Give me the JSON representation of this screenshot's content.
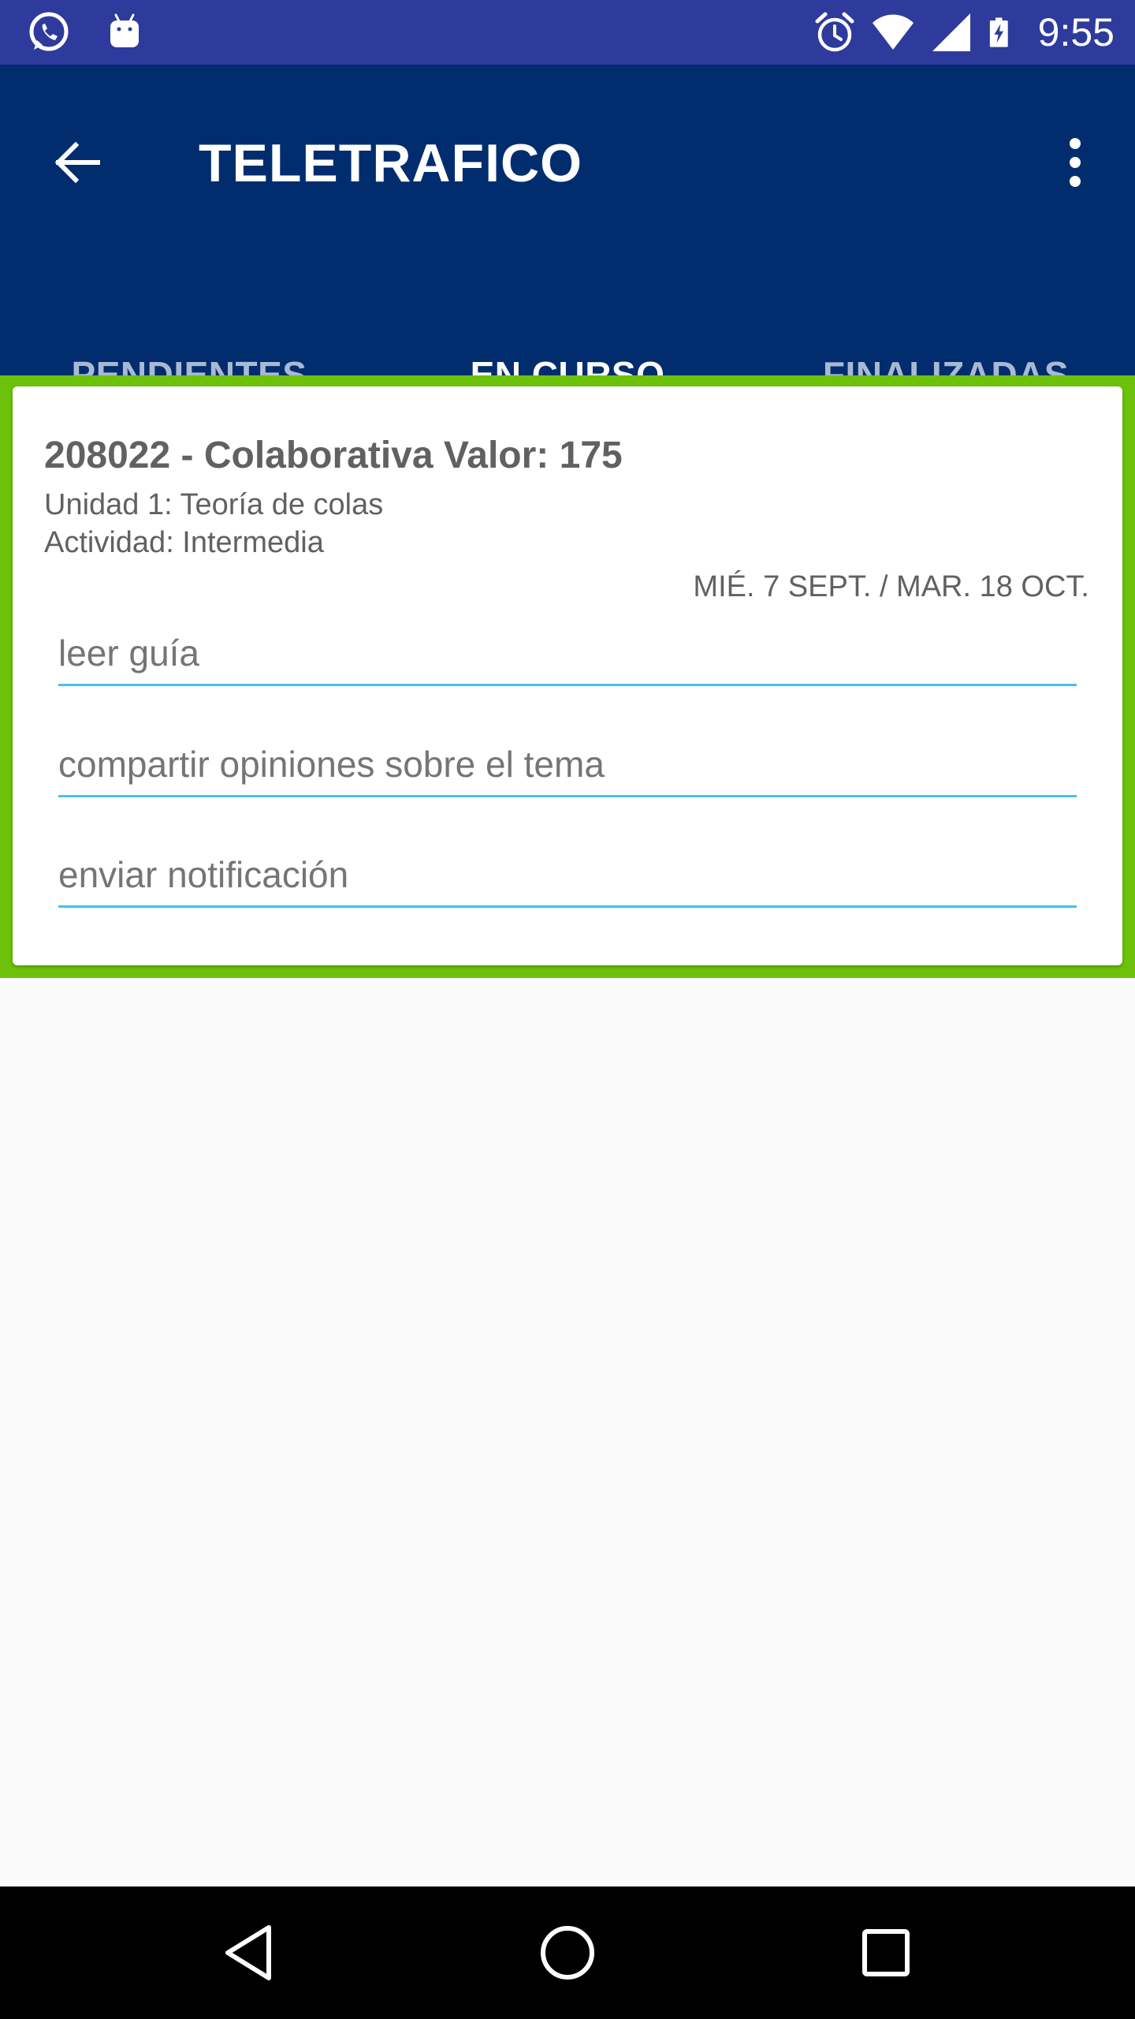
{
  "status_bar": {
    "time": "9:55",
    "left_icons": [
      "whatsapp-icon",
      "android-icon"
    ],
    "right_icons": [
      "alarm-icon",
      "wifi-icon",
      "signal-icon",
      "battery-charging-icon"
    ]
  },
  "app_bar": {
    "title": "TELETRAFICO",
    "back_icon": "arrow-back-icon",
    "menu_icon": "more-vert-icon"
  },
  "tabs": [
    {
      "label": "PENDIENTES",
      "active": false
    },
    {
      "label": "EN CURSO",
      "active": true
    },
    {
      "label": "FINALIZADAS",
      "active": false
    }
  ],
  "card": {
    "title": "208022 - Colaborativa Valor: 175",
    "unit": "Unidad 1: Teoría de colas",
    "activity": "Actividad: Intermedia",
    "dates": "MIÉ. 7 SEPT. / MAR. 18 OCT.",
    "tasks": [
      {
        "value": "leer guía"
      },
      {
        "value": "compartir opiniones sobre el tema"
      },
      {
        "value": "enviar notificación"
      }
    ]
  },
  "nav_bar": {
    "icons": [
      "nav-back-icon",
      "nav-home-icon",
      "nav-recents-icon"
    ]
  },
  "colors": {
    "status_bar": "#2e3b9c",
    "app_bar": "#012d6e",
    "tab_indicator": "#3fc3ef",
    "card_frame": "#6cc20a",
    "field_underline": "#3fc3ef"
  }
}
